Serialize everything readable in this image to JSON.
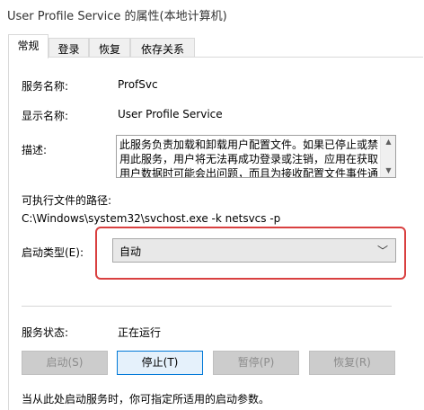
{
  "window": {
    "title": "User Profile Service 的属性(本地计算机)"
  },
  "tabs": [
    "常规",
    "登录",
    "恢复",
    "依存关系"
  ],
  "general": {
    "service_name_label": "服务名称:",
    "service_name": "ProfSvc",
    "display_name_label": "显示名称:",
    "display_name": "User Profile Service",
    "description_label": "描述:",
    "description": "此服务负责加载和卸载用户配置文件。如果已停止或禁用此服务，用户将无法再成功登录或注销，应用在获取用户数据时可能会出问题，而且为接收配置文件事件通",
    "exec_path_label": "可执行文件的路径:",
    "exec_path": "C:\\Windows\\system32\\svchost.exe -k netsvcs -p",
    "startup_type_label": "启动类型(E):",
    "startup_type": "自动",
    "status_label": "服务状态:",
    "status": "正在运行",
    "buttons": {
      "start": "启动(S)",
      "stop": "停止(T)",
      "pause": "暂停(P)",
      "resume": "恢复(R)"
    },
    "hint": "当从此处启动服务时，你可指定所适用的启动参数。"
  },
  "colors": {
    "highlight": "#d94040",
    "accent": "#0078d7"
  },
  "icons": {
    "dropdown": "chevron-down-icon",
    "scroll_up": "arrow-up-icon",
    "scroll_down": "arrow-down-icon"
  }
}
